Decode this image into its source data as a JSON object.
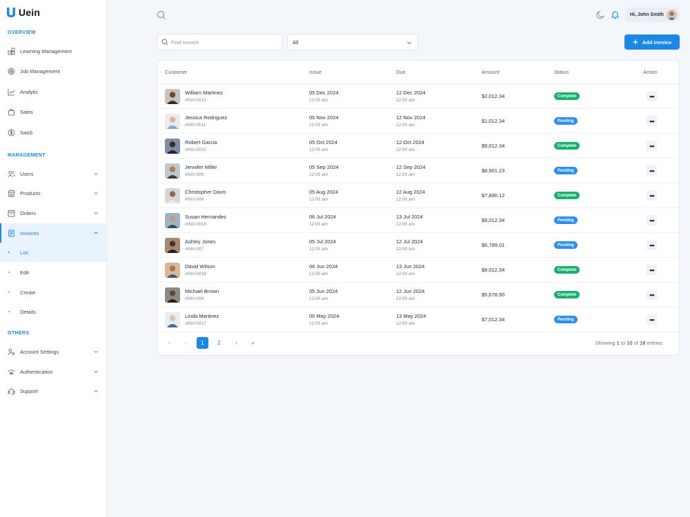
{
  "brand": {
    "name": "Uein",
    "color": "#1b87e6"
  },
  "sidebar": {
    "sections": [
      "OVERVIEW",
      "MANAGEMENT",
      "OTHERS"
    ],
    "overview": [
      {
        "label": "Learning Management",
        "icon": "learning-icon"
      },
      {
        "label": "Job Management",
        "icon": "target-icon"
      },
      {
        "label": "Analytic",
        "icon": "chart-icon"
      },
      {
        "label": "Sales",
        "icon": "bag-icon"
      },
      {
        "label": "SaaS",
        "icon": "dollar-icon"
      }
    ],
    "management": [
      {
        "label": "Users",
        "icon": "users-icon"
      },
      {
        "label": "Products",
        "icon": "store-icon"
      },
      {
        "label": "Orders",
        "icon": "box-icon"
      },
      {
        "label": "Invoices",
        "icon": "document-icon",
        "expanded": true
      }
    ],
    "invoice_sub": [
      "List",
      "Edit",
      "Create",
      "Details"
    ],
    "others": [
      {
        "label": "Account Settings",
        "icon": "user-settings-icon"
      },
      {
        "label": "Authentication",
        "icon": "shield-icon"
      },
      {
        "label": "Support",
        "icon": "headset-icon"
      }
    ]
  },
  "header": {
    "greeting": "Hi, John Smith"
  },
  "toolbar": {
    "search_placeholder": "Find Invoice",
    "filter_value": "All",
    "add_label": "Add Invoice"
  },
  "table": {
    "headers": [
      "Customer",
      "Issue",
      "Due",
      "Amount",
      "Status",
      "Action"
    ],
    "rows": [
      {
        "name": "William Martinez",
        "id": "#INV-0012",
        "issue": "05 Dec 2024",
        "issue_time": "12:00 am",
        "due": "12 Dec 2024",
        "due_time": "12:00 am",
        "amount": "$2,012.34",
        "status": "Complete"
      },
      {
        "name": "Jessica Rodriguez",
        "id": "#INV-0011",
        "issue": "05 Nov 2024",
        "issue_time": "12:00 am",
        "due": "12 Nov 2024",
        "due_time": "12:00 am",
        "amount": "$1,012.34",
        "status": "Pending"
      },
      {
        "name": "Robert Garcia",
        "id": "#INV-0010",
        "issue": "05 Oct 2024",
        "issue_time": "12:00 am",
        "due": "12 Oct 2024",
        "due_time": "12:00 am",
        "amount": "$9,012.34",
        "status": "Complete"
      },
      {
        "name": "Jennifer Miller",
        "id": "#INV-009",
        "issue": "05 Sep 2024",
        "issue_time": "12:00 am",
        "due": "12 Sep 2024",
        "due_time": "12:00 am",
        "amount": "$8,901.23",
        "status": "Pending"
      },
      {
        "name": "Christopher Davis",
        "id": "#INV-008",
        "issue": "05 Aug 2024",
        "issue_time": "12:00 am",
        "due": "12 Aug 2024",
        "due_time": "12:00 am",
        "amount": "$7,890.12",
        "status": "Complete"
      },
      {
        "name": "Susan Hernandez",
        "id": "#INV-0019",
        "issue": "06 Jul 2024",
        "issue_time": "12:00 am",
        "due": "13 Jul 2024",
        "due_time": "12:00 am",
        "amount": "$9,012.34",
        "status": "Pending"
      },
      {
        "name": "Ashley Jones",
        "id": "#INV-007",
        "issue": "05 Jul 2024",
        "issue_time": "12:00 am",
        "due": "12 Jul 2024",
        "due_time": "12:00 am",
        "amount": "$6,789.01",
        "status": "Pending"
      },
      {
        "name": "David Wilson",
        "id": "#INV-0018",
        "issue": "06 Jun 2024",
        "issue_time": "12:00 am",
        "due": "13 Jun 2024",
        "due_time": "12:00 am",
        "amount": "$8,012.34",
        "status": "Complete"
      },
      {
        "name": "Michael Brown",
        "id": "#INV-006",
        "issue": "05 Jun 2024",
        "issue_time": "12:00 am",
        "due": "12 Jun 2024",
        "due_time": "12:00 am",
        "amount": "$5,678.90",
        "status": "Complete"
      },
      {
        "name": "Linda Martinez",
        "id": "#INV-0017",
        "issue": "06 May 2024",
        "issue_time": "12:00 am",
        "due": "13 May 2024",
        "due_time": "12:00 am",
        "amount": "$7,012.34",
        "status": "Pending"
      }
    ],
    "action_glyph": "•••"
  },
  "pagination": {
    "first": "«",
    "prev": "‹",
    "pages": [
      "1",
      "2"
    ],
    "next": "›",
    "last": "»",
    "current": "1",
    "showing_prefix": "Showing",
    "from": "1",
    "to_word": "to",
    "to": "10",
    "of_word": "of",
    "total": "18",
    "suffix": "entries"
  },
  "colors": {
    "accent": "#1b87e6",
    "complete": "#17b26a",
    "pending": "#2b8ef0"
  }
}
